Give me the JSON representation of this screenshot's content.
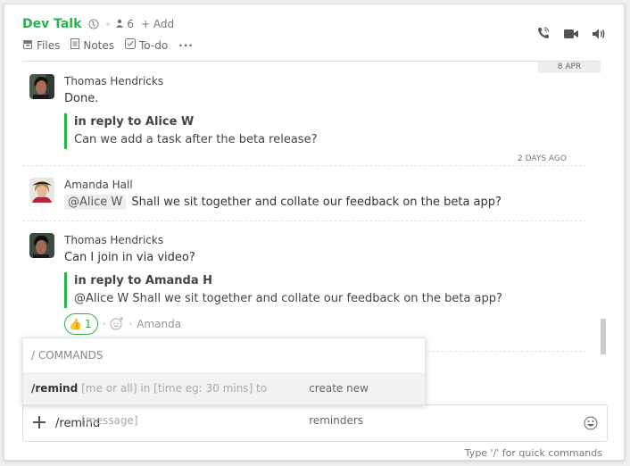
{
  "header": {
    "title": "Dev Talk",
    "member_count": "6",
    "add_label": "+ Add",
    "tabs": [
      {
        "label": "Files",
        "icon": "archive-icon"
      },
      {
        "label": "Notes",
        "icon": "notes-icon"
      },
      {
        "label": "To-do",
        "icon": "checkbox-icon"
      }
    ],
    "more_label": "···",
    "actions": [
      "phone-call-icon",
      "video-camera-icon",
      "speaker-icon"
    ]
  },
  "colors": {
    "accent": "#2ab14d",
    "mention_bg": "#eeeeee"
  },
  "messages": {
    "date_pill": "8 APR",
    "items": [
      {
        "author": "Thomas Hendricks",
        "text": "Done.",
        "reply_to": "in reply to Alice W",
        "reply_text": "Can we add a task after the beta release?",
        "timestamp": "2 DAYS AGO"
      },
      {
        "author": "Amanda Hall",
        "mention": "@Alice W",
        "text": "Shall we sit together and collate our feedback on the beta app?"
      },
      {
        "author": "Thomas Hendricks",
        "text": "Can I join in via video?",
        "reply_to": "in reply to Amanda H",
        "reply_text": "@Alice W Shall we sit together and collate our feedback on the beta app?",
        "reaction": {
          "emoji": "👍",
          "count": "1"
        },
        "reacted_by": "Amanda"
      }
    ]
  },
  "commands": {
    "header": "/ COMMANDS",
    "items": [
      {
        "name": "/remind",
        "args": "[me or all] in [time eg: 30 mins] to [message]",
        "description": "create new reminders"
      }
    ]
  },
  "composer": {
    "value": "/remind",
    "hint": "Type '/' for quick commands"
  }
}
